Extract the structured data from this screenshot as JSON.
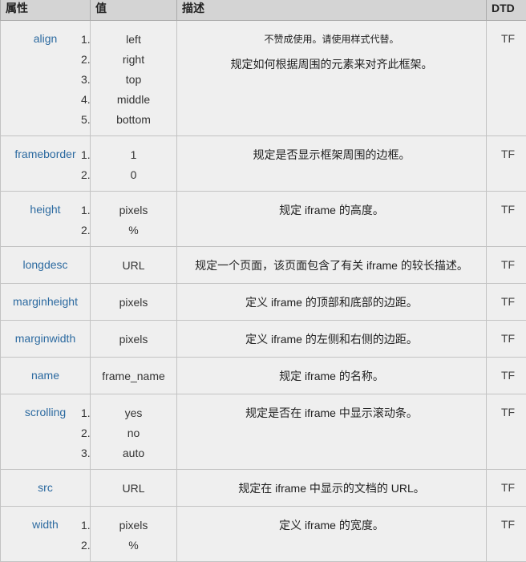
{
  "header": {
    "attribute": "属性",
    "value": "值",
    "description": "描述",
    "dtd": "DTD"
  },
  "rows": [
    {
      "attr": "align",
      "values": [
        "left",
        "right",
        "top",
        "middle",
        "bottom"
      ],
      "desc": [
        "不赞成使用。请使用样式代替。",
        "规定如何根据周围的元素来对齐此框架。"
      ],
      "dtd": "TF",
      "height": 144
    },
    {
      "attr": "frameborder",
      "values": [
        "1",
        "0"
      ],
      "desc": [
        "规定是否显示框架周围的边框。"
      ],
      "dtd": "TF",
      "height": 69
    },
    {
      "attr": "height",
      "values": [
        "pixels",
        "%"
      ],
      "desc": [
        "规定 iframe 的高度。"
      ],
      "dtd": "TF",
      "height": 69
    },
    {
      "attr": "longdesc",
      "values": [
        "URL"
      ],
      "desc": [
        "规定一个页面，该页面包含了有关 iframe 的较长描述。"
      ],
      "dtd": "TF",
      "height": 36
    },
    {
      "attr": "marginheight",
      "values": [
        "pixels"
      ],
      "desc": [
        "定义 iframe 的顶部和底部的边距。"
      ],
      "dtd": "TF",
      "height": 36
    },
    {
      "attr": "marginwidth",
      "values": [
        "pixels"
      ],
      "desc": [
        "定义 iframe 的左侧和右侧的边距。"
      ],
      "dtd": "TF",
      "height": 36
    },
    {
      "attr": "name",
      "values": [
        "frame_name"
      ],
      "desc": [
        "规定 iframe 的名称。"
      ],
      "dtd": "TF",
      "height": 36
    },
    {
      "attr": "scrolling",
      "values": [
        "yes",
        "no",
        "auto"
      ],
      "desc": [
        "规定是否在 iframe 中显示滚动条。"
      ],
      "dtd": "TF",
      "height": 94
    },
    {
      "attr": "src",
      "values": [
        "URL"
      ],
      "desc": [
        "规定在 iframe 中显示的文档的 URL。"
      ],
      "dtd": "TF",
      "height": 36
    },
    {
      "attr": "width",
      "values": [
        "pixels",
        "%"
      ],
      "desc": [
        "定义 iframe 的宽度。"
      ],
      "dtd": "TF",
      "height": 69
    }
  ]
}
